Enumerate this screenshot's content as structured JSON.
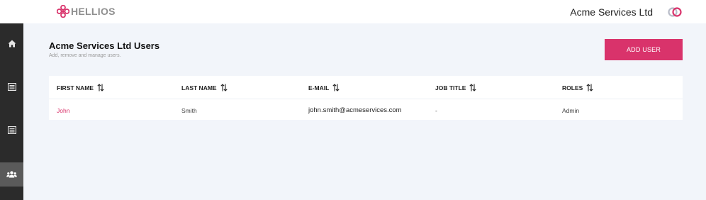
{
  "app": {
    "brand": "HELLIOS",
    "organization": "Acme Services Ltd"
  },
  "sidebar": {
    "items": [
      {
        "icon": "home-icon"
      },
      {
        "icon": "list-icon"
      },
      {
        "icon": "list-icon"
      },
      {
        "icon": "users-icon",
        "active": true
      }
    ]
  },
  "page": {
    "title": "Acme Services Ltd Users",
    "subtitle": "Add, remove and manage users.",
    "add_button": "ADD USER"
  },
  "table": {
    "columns": [
      "FIRST NAME",
      "LAST NAME",
      "E-MAIL",
      "JOB TITLE",
      "ROLES"
    ],
    "rows": [
      {
        "first_name": "John",
        "last_name": "Smith",
        "email": "john.smith@acmeservices.com",
        "job_title": "-",
        "roles": "Admin"
      }
    ]
  },
  "colors": {
    "accent": "#d9336b",
    "sidebar": "#2b2b2b",
    "background": "#f2f5fa"
  }
}
